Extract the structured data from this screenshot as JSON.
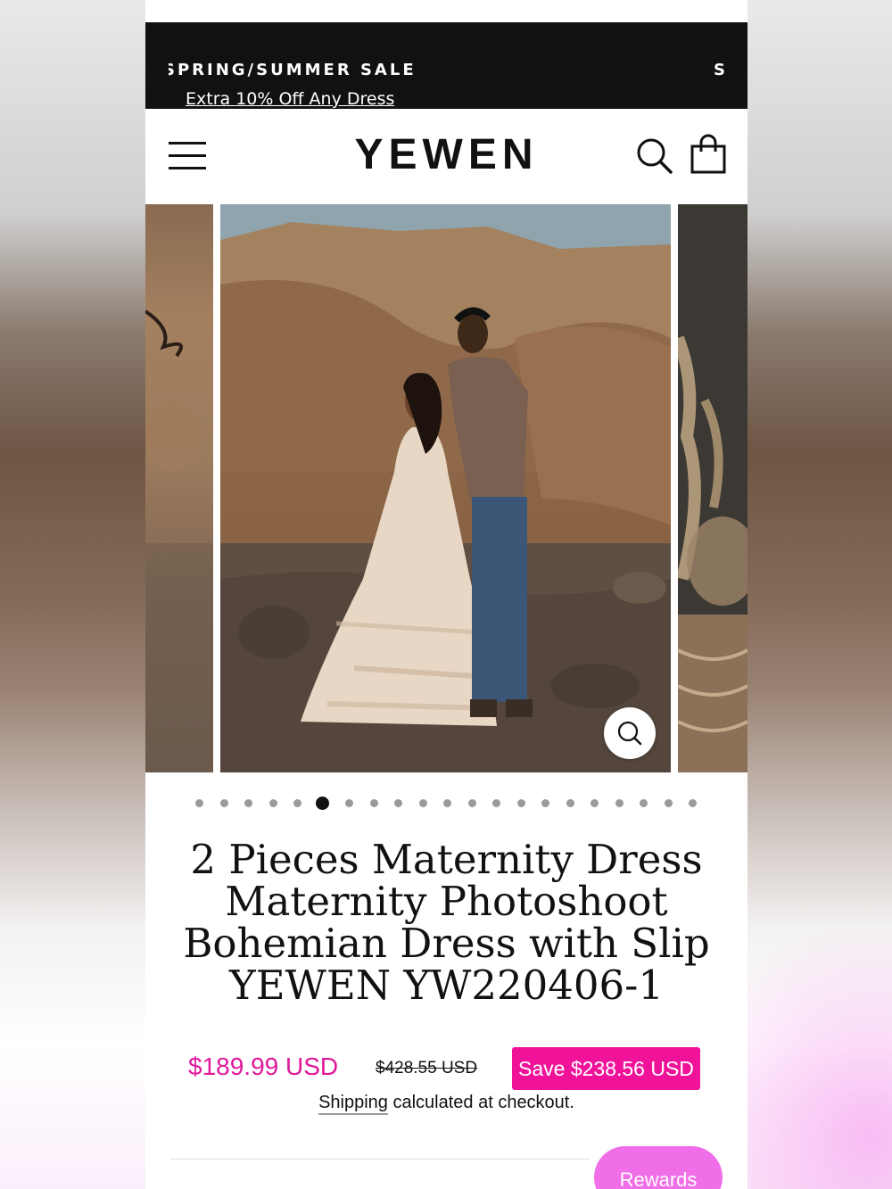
{
  "announcement": {
    "title": "SPRING/SUMMER SALE",
    "next_title_fragment": "S",
    "link": "Extra 10% Off Any Dress"
  },
  "header": {
    "logo": "YEWEN",
    "icons": [
      "menu-icon",
      "search-icon",
      "cart-icon"
    ]
  },
  "gallery": {
    "slide_count": 21,
    "active_index": 5,
    "zoom_icon": "zoom-icon"
  },
  "product": {
    "title": "2 Pieces Maternity Dress Maternity Photoshoot Bohemian Dress with Slip YEWEN YW220406-1",
    "price": "$189.99 USD",
    "compare_price": "$428.55 USD",
    "save": "Save $238.56 USD",
    "shipping_link": "Shipping",
    "shipping_rest": " calculated at checkout."
  },
  "rewards": {
    "label": "Rewards"
  },
  "colors": {
    "sale_pink": "#f0139a",
    "price_pink": "#e0189b",
    "rewards_pink": "#f06ee7",
    "announce_bg": "#111111"
  }
}
